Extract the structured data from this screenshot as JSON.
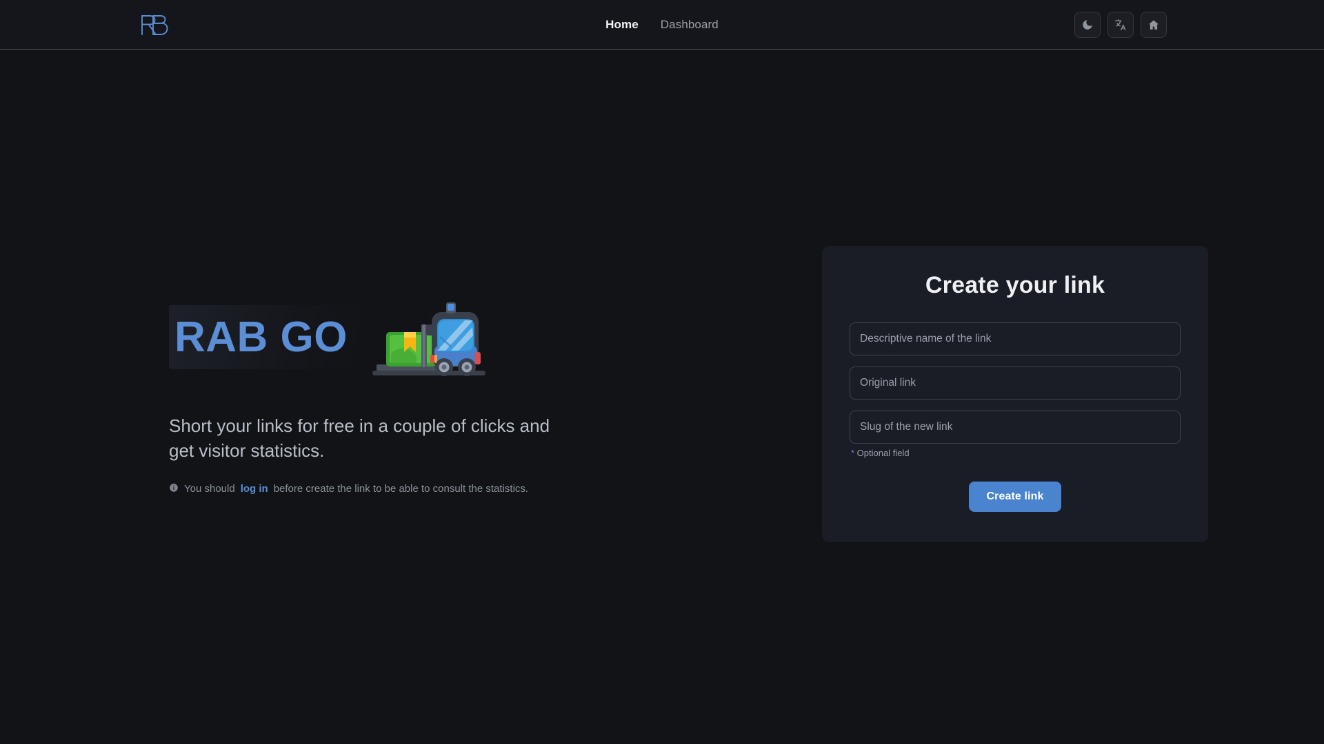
{
  "header": {
    "logo_text": "RB",
    "logo_color": "#5b8ed4",
    "nav": [
      {
        "label": "Home",
        "active": true
      },
      {
        "label": "Dashboard",
        "active": false
      }
    ],
    "actions": [
      {
        "name": "theme-toggle",
        "icon": "moon-icon"
      },
      {
        "name": "language-toggle",
        "icon": "translate-icon"
      },
      {
        "name": "home-button",
        "icon": "home-icon"
      }
    ]
  },
  "hero": {
    "title": "RAB GO",
    "title_color": "#5b8ed4",
    "subtitle": "Short your links for free in a couple of clicks and get visitor statistics.",
    "note": {
      "icon": "info-icon",
      "prefix": "You should ",
      "link_text": "log in",
      "suffix": " before create the link to be able to consult the statistics."
    },
    "illustration": "forklift-illustration"
  },
  "card": {
    "title": "Create your link",
    "fields": [
      {
        "name": "link-name-input",
        "placeholder": "Descriptive name of the link",
        "value": ""
      },
      {
        "name": "original-link-input",
        "placeholder": "Original link",
        "value": ""
      },
      {
        "name": "slug-input",
        "placeholder": "Slug of the new link",
        "value": ""
      }
    ],
    "optional_star": "*",
    "optional_text": " Optional field",
    "submit_label": "Create link",
    "accent_color": "#4a83ce"
  }
}
